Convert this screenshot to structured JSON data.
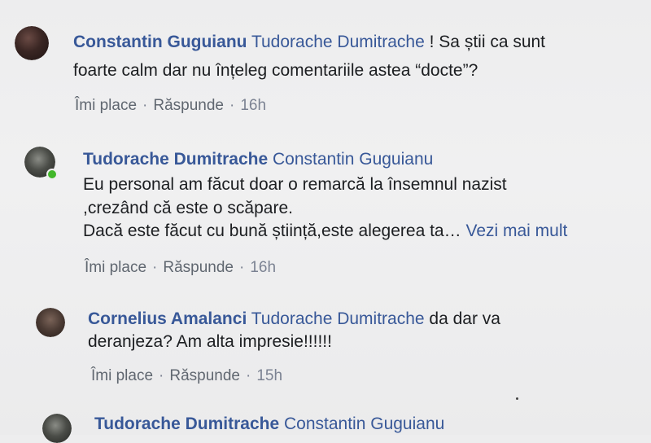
{
  "comments": [
    {
      "author": "Constantin Guguianu",
      "mention": "Tudorache Dumitrache",
      "lines": [
        "! Sa știi ca sunt",
        "foarte calm dar nu înțeleg comentariile astea “docte”?"
      ],
      "like": "Îmi place",
      "reply": "Răspunde",
      "time": "16h"
    },
    {
      "author": "Tudorache Dumitrache",
      "mention": "Constantin Guguianu",
      "lines": [
        "Eu personal am făcut doar o remarcă la însemnul nazist",
        ",crezând că este o scăpare.",
        "Dacă este făcut cu bună știință,este alegerea ta…"
      ],
      "see_more": "Vezi mai mult",
      "like": "Îmi place",
      "reply": "Răspunde",
      "time": "16h"
    },
    {
      "author": "Cornelius Amalanci",
      "mention": "Tudorache Dumitrache",
      "lines": [
        "da dar va",
        "deranjeza? Am alta impresie!!!!!!"
      ],
      "like": "Îmi place",
      "reply": "Răspunde",
      "time": "15h"
    },
    {
      "author": "Tudorache Dumitrache",
      "mention": "Constantin Guguianu"
    }
  ],
  "separator": "·",
  "colors": {
    "link_blue": "#385898",
    "text": "#1c1e21",
    "meta": "#7b8292",
    "online": "#42b72a"
  }
}
